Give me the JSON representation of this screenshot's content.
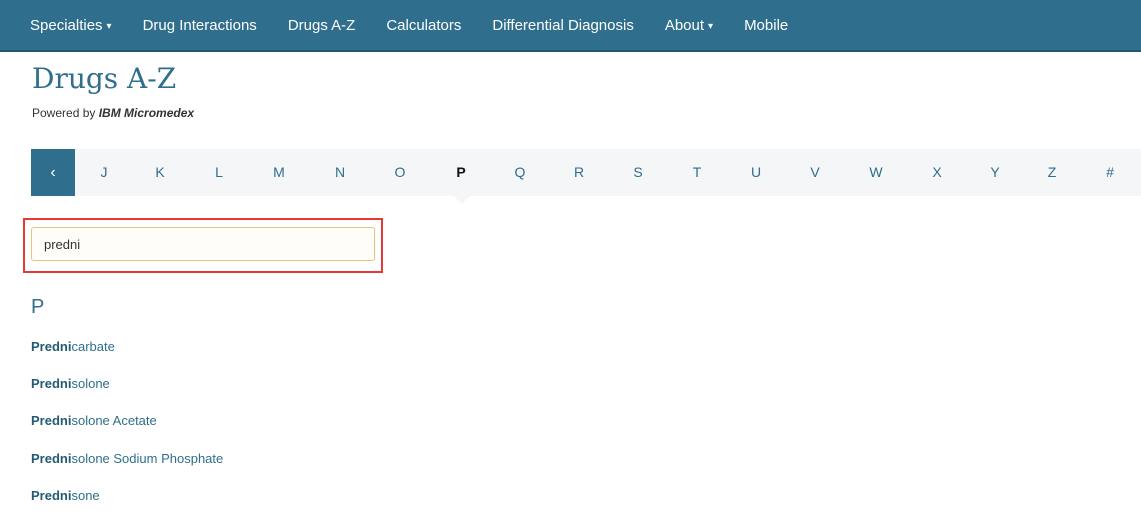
{
  "nav": {
    "items": [
      "Specialties",
      "Drug Interactions",
      "Drugs A-Z",
      "Calculators",
      "Differential Diagnosis",
      "About",
      "Mobile"
    ],
    "dropdown_items": [
      "Specialties",
      "About"
    ]
  },
  "header": {
    "title": "Drugs A-Z",
    "powered_prefix": "Powered by ",
    "powered_brand": "IBM Micromedex"
  },
  "letters": {
    "prev_label": "‹",
    "items": [
      "J",
      "K",
      "L",
      "M",
      "N",
      "O",
      "P",
      "Q",
      "R",
      "S",
      "T",
      "U",
      "V",
      "W",
      "X",
      "Y",
      "Z",
      "#"
    ],
    "active": "P"
  },
  "search": {
    "value": "predni"
  },
  "results": {
    "section": "P",
    "items": [
      {
        "match": "Predni",
        "rest": "carbate"
      },
      {
        "match": "Predni",
        "rest": "solone"
      },
      {
        "match": "Predni",
        "rest": "solone Acetate"
      },
      {
        "match": "Predni",
        "rest": "solone Sodium Phosphate"
      },
      {
        "match": "Predni",
        "rest": "sone"
      }
    ]
  },
  "colors": {
    "brand": "#2f6f8d",
    "highlight": "#e53935",
    "input_border": "#e8c27f"
  }
}
